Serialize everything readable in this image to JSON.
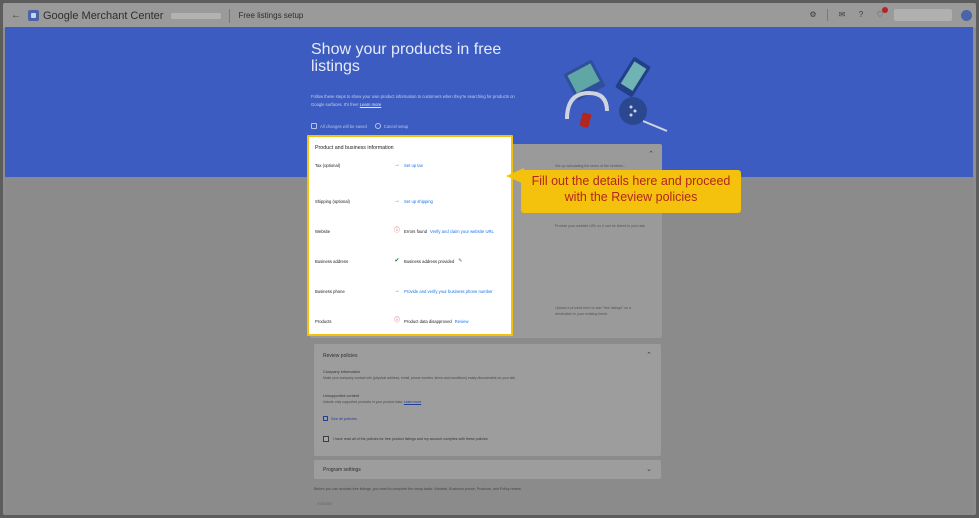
{
  "topbar": {
    "back_icon": "arrow-left-icon",
    "brand": "Google Merchant Center",
    "page_heading": "Free listings setup",
    "icons": [
      "gear-icon",
      "mail-icon",
      "help-icon",
      "bell-icon",
      "account-avatar-icon"
    ]
  },
  "hero": {
    "title": "Show your products in free listings",
    "subtitle": "Follow these steps to show your own product information to customers when they're searching for products on Google surfaces. It's free!",
    "subtitle_link": "Learn more",
    "save_note": "All changes will be saved",
    "cancel_label": "Cancel setup",
    "colors": {
      "hero_bg": "#3c5cc2",
      "highlight": "#f4c20d",
      "callout_text": "#b3261e"
    }
  },
  "product_info": {
    "title": "Product and business information",
    "rows": [
      {
        "label": "Tax (optional)",
        "icon": "arrow-right-icon",
        "value": "Set up tax"
      },
      {
        "label": "Shipping (optional)",
        "icon": "arrow-right-icon",
        "value": "Set up shipping"
      },
      {
        "label": "Website",
        "icon": "error-icon",
        "value": "Errors found",
        "link": "Verify and claim your website URL"
      },
      {
        "label": "Business address",
        "icon": "check-circle-icon",
        "value": "Business address provided"
      },
      {
        "label": "Business phone",
        "icon": "arrow-right-icon",
        "value": "Provide and verify your business phone number"
      },
      {
        "label": "Products",
        "icon": "error-icon",
        "value": "Product data disapproved",
        "link": "Review"
      }
    ],
    "side_notes": [
      "Set up calculating the taxes of the vehicles...",
      "Shipping settings are required in your feed",
      "Provide your website URL so it can be linked to your ads",
      "Upload a product feed or add \"free listings\" as a destination in your existing feeds"
    ]
  },
  "callout": {
    "text": "Fill out the details here and proceed with the Review policies"
  },
  "review_policies": {
    "title": "Review policies",
    "company_heading": "Company information",
    "company_text": "Make your company contact info (physical address, email, phone number, terms and conditions) easily discoverable on your site.",
    "unsupported_heading": "Unsupported content",
    "unsupported_text": "Include only supported products in your product data.",
    "unsupported_link": "Learn more",
    "see_all": "See all policies",
    "acknowledge": "I have read all of the policies for free product listings and my account complies with these policies"
  },
  "program_settings": {
    "title": "Program settings"
  },
  "footer": {
    "note": "Before you can activate free listings, you need to complete the setup tasks: Website, Business phone, Products, and Policy review.",
    "activate_label": "Activate"
  }
}
